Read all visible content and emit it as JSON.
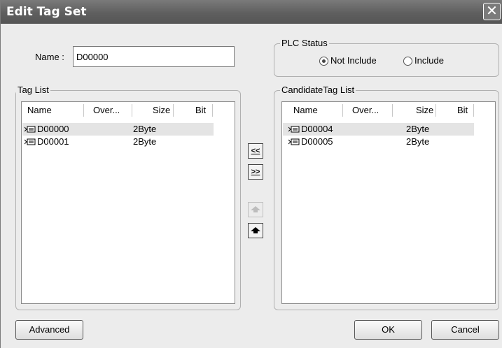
{
  "window": {
    "title": "Edit Tag Set",
    "close_glyph": "✕"
  },
  "name_field": {
    "label": "Name :",
    "value": "D00000"
  },
  "plc_status": {
    "legend": "PLC Status",
    "options": [
      {
        "label": "Not Include",
        "selected": true
      },
      {
        "label": "Include",
        "selected": false
      }
    ]
  },
  "tag_list": {
    "legend": "Tag List",
    "columns": [
      "Name",
      "Over...",
      "Size",
      "Bit"
    ],
    "rows": [
      {
        "name": "D00000",
        "over": "",
        "size": "2Byte",
        "bit": "",
        "selected": true
      },
      {
        "name": "D00001",
        "over": "",
        "size": "2Byte",
        "bit": "",
        "selected": false
      }
    ]
  },
  "candidate_list": {
    "legend": "CandidateTag List",
    "columns": [
      "Name",
      "Over...",
      "Size",
      "Bit"
    ],
    "rows": [
      {
        "name": "D00004",
        "over": "",
        "size": "2Byte",
        "bit": "",
        "selected": true
      },
      {
        "name": "D00005",
        "over": "",
        "size": "2Byte",
        "bit": "",
        "selected": false
      }
    ]
  },
  "transfer_buttons": {
    "add_label": "<<",
    "remove_label": ">>",
    "move_up_icon": "arrow-up-icon",
    "move_down_icon": "arrow-down-icon"
  },
  "footer": {
    "advanced_label": "Advanced",
    "ok_label": "OK",
    "cancel_label": "Cancel"
  }
}
